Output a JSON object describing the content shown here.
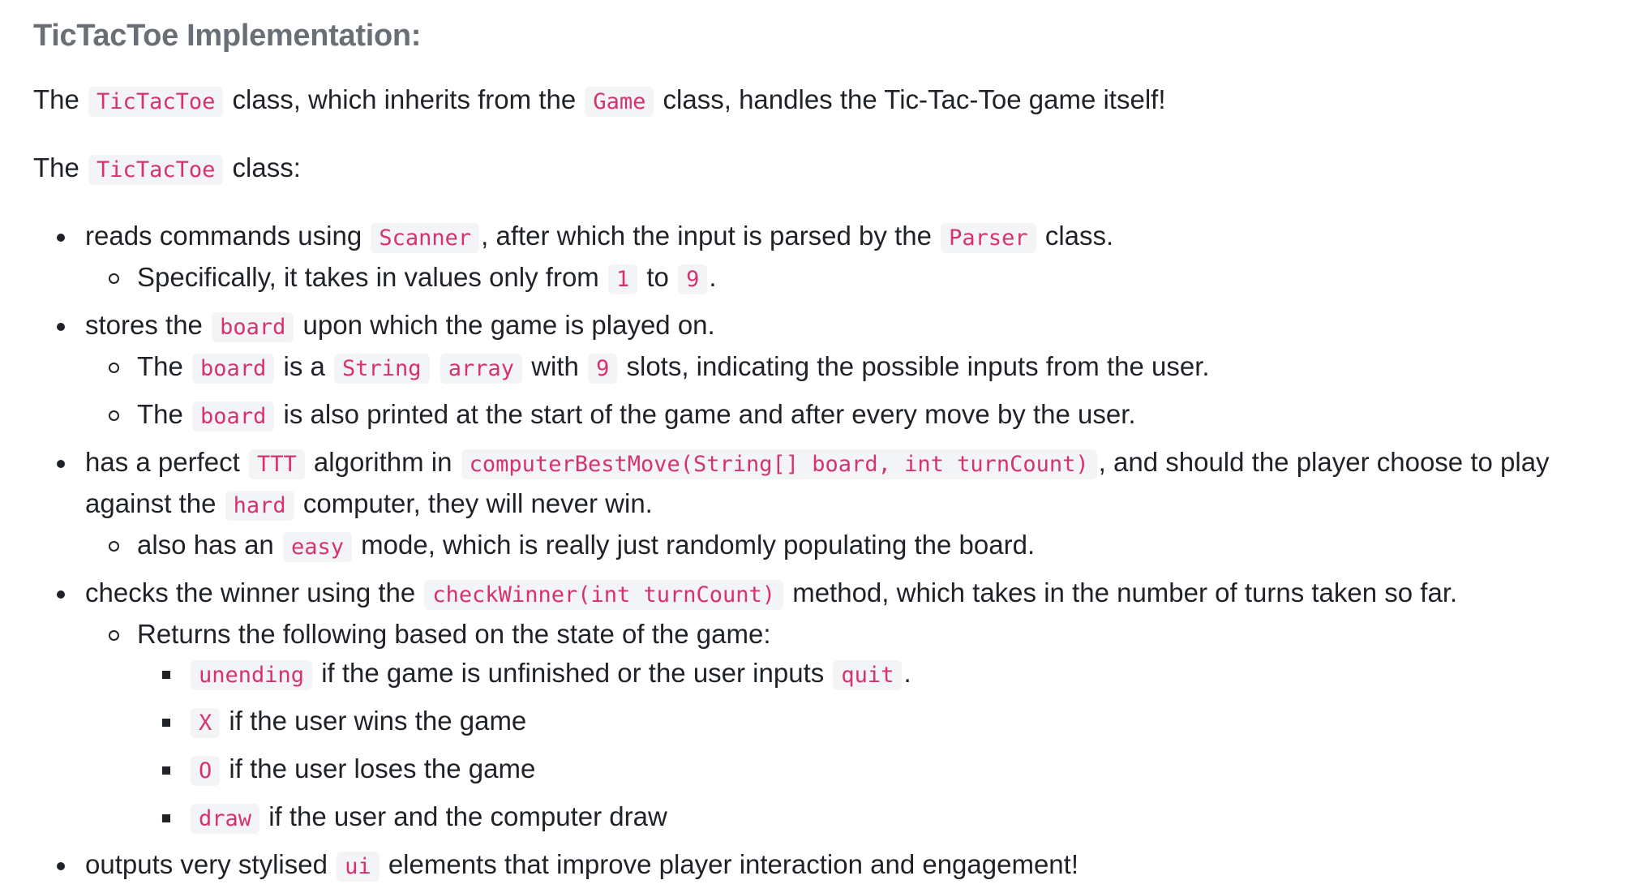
{
  "heading": "TicTacToe Implementation:",
  "intro": {
    "t1": "The ",
    "c1": "TicTacToe",
    "t2": " class, which inherits from the ",
    "c2": "Game",
    "t3": " class, handles the Tic-Tac-Toe game itself!"
  },
  "intro2": {
    "t1": "The ",
    "c1": "TicTacToe",
    "t2": " class:"
  },
  "items": [
    {
      "t1": "reads commands using ",
      "c1": "Scanner",
      "t2": ", after which the input is parsed by the ",
      "c2": "Parser",
      "t3": " class.",
      "sub": [
        {
          "t1": "Specifically, it takes in values only from ",
          "c1": "1",
          "t2": " to ",
          "c2": "9",
          "t3": "."
        }
      ]
    },
    {
      "t1": "stores the ",
      "c1": "board",
      "t2": " upon which the game is played on.",
      "sub": [
        {
          "t1": "The ",
          "c1": "board",
          "t2": " is a ",
          "c2": "String",
          "c3": "array",
          "t3": " with ",
          "c4": "9",
          "t4": " slots, indicating the possible inputs from the user."
        },
        {
          "t1": "The ",
          "c1": "board",
          "t2": " is also printed at the start of the game and after every move by the user."
        }
      ]
    },
    {
      "t1": "has a perfect ",
      "c1": "TTT",
      "t2": " algorithm in ",
      "c2": "computerBestMove(String[] board, int turnCount)",
      "t3": ", and should the player choose to play against the ",
      "c3": "hard",
      "t4": " computer, they will never win.",
      "sub": [
        {
          "t1": "also has an ",
          "c1": "easy",
          "t2": " mode, which is really just randomly populating the board."
        }
      ]
    },
    {
      "t1": "checks the winner using the ",
      "c1": "checkWinner(int turnCount)",
      "t2": " method, which takes in the number of turns taken so far.",
      "sub": [
        {
          "t1": "Returns the following based on the state of the game:",
          "sub": [
            {
              "c1": "unending",
              "t1": " if the game is unfinished or the user inputs ",
              "c2": "quit",
              "t2": "."
            },
            {
              "c1": "X",
              "t1": " if the user wins the game"
            },
            {
              "c1": "O",
              "t1": " if the user loses the game"
            },
            {
              "c1": "draw",
              "t1": " if the user and the computer draw"
            }
          ]
        }
      ]
    },
    {
      "t1": "outputs very stylised ",
      "c1": "ui",
      "t2": " elements that improve player interaction and engagement!"
    }
  ]
}
